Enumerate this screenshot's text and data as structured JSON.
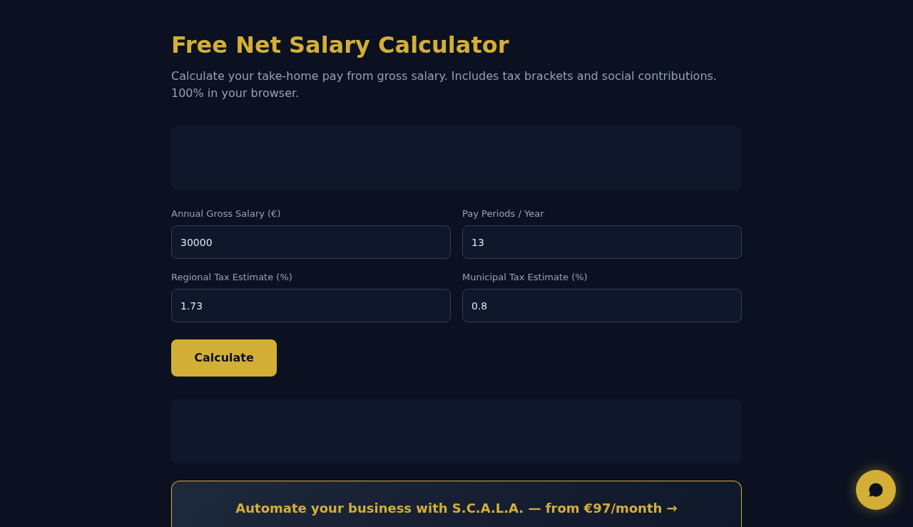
{
  "header": {
    "title": "Free Net Salary Calculator",
    "subtitle": "Calculate your take-home pay from gross salary. Includes tax brackets and social contributions. 100% in your browser."
  },
  "fields": [
    {
      "label": "Annual Gross Salary (€)",
      "value": "30000"
    },
    {
      "label": "Pay Periods / Year",
      "value": "13"
    },
    {
      "label": "Regional Tax Estimate (%)",
      "value": "1.73"
    },
    {
      "label": "Municipal Tax Estimate (%)",
      "value": "0.8"
    }
  ],
  "calculate_button": {
    "label": "Calculate"
  },
  "promo_banner": {
    "text": "Automate your business with S.C.A.L.A. — from €97/month →"
  }
}
